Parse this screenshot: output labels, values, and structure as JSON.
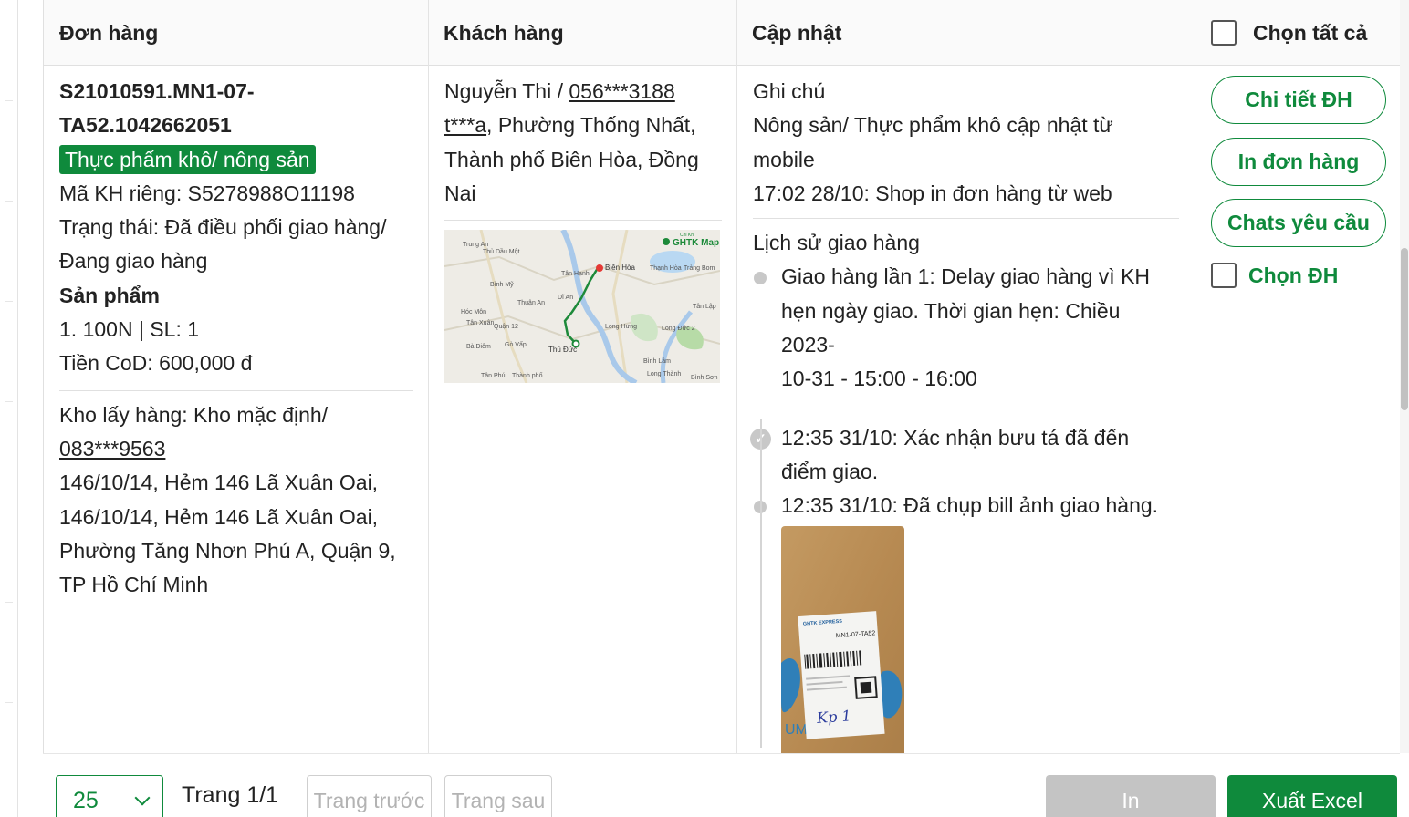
{
  "header": {
    "col_order": "Đơn hàng",
    "col_customer": "Khách hàng",
    "col_update": "Cập nhật",
    "select_all": "Chọn tất cả"
  },
  "order": {
    "code_line1": "S21010591.MN1-07-",
    "code_line2": "TA52.1042662051",
    "tag": "Thực phẩm khô/ nông sản",
    "customer_code": "Mã KH riêng: S5278988O11198",
    "status_line1": "Trạng thái: Đã điều phối giao hàng/",
    "status_line2": "Đang giao hàng",
    "products_heading": "Sản phẩm",
    "product_item": "1. 100N | SL: 1",
    "cod": "Tiền CoD: 600,000 đ",
    "pickup_prefix": "Kho lấy hàng: Kho mặc định/",
    "pickup_phone": "083***9563",
    "pickup_addr_line1": "146/10/14, Hẻm 146 Lã Xuân Oai,",
    "pickup_addr_line2": "146/10/14, Hẻm 146 Lã Xuân Oai,",
    "pickup_addr_line3": "Phường Tăng Nhơn Phú A, Quận 9,",
    "pickup_addr_line4": "TP Hồ Chí Minh"
  },
  "customer": {
    "name_prefix": "Nguyễn Thi / ",
    "phone": "056***3188",
    "addr_masked": "t***a",
    "addr_rest_line1": ", Phường Thống Nhất,",
    "addr_line2": "Thành phố Biên Hòa, Đồng",
    "addr_line3": "Nai",
    "map": {
      "brand": "GHTK Map",
      "brand_sup": "Chi Khi",
      "labels": [
        "Trung An",
        "Thủ Dầu Một",
        "Biên Hòa",
        "Tân Hạnh",
        "Thạnh Hòa",
        "Trảng Bom",
        "Bình Mỹ",
        "Dĩ An",
        "Thuận An",
        "Hóc Môn",
        "Tân Xuân",
        "Quận 12",
        "Tân Lập",
        "Long Hưng",
        "Long Đức 2",
        "Gò Vấp",
        "Bà Điểm",
        "Thủ Đức",
        "Bình Lâm",
        "Tân Phú",
        "Thành phố",
        "Long Thành",
        "Bình Sơn"
      ]
    }
  },
  "update": {
    "note_title": "Ghi chú",
    "note_line1": "Nông sản/ Thực phẩm khô cập nhật từ",
    "note_line2": "mobile",
    "note_line3": "17:02 28/10: Shop in đơn hàng từ web",
    "history_title": "Lịch sử giao hàng",
    "history_line1": "Giao hàng lần 1: Delay giao hàng vì KH",
    "history_line2": "hẹn ngày giao. Thời gian hẹn: Chiều 2023-",
    "history_line3": "10-31 - 15:00 - 16:00",
    "event1_line1": "12:35 31/10: Xác nhận bưu tá đã đến",
    "event1_line2": "điểm giao.",
    "event2": "12:35 31/10: Đã chụp bill ảnh giao hàng.",
    "photo": {
      "label_brand": "GHTK EXPRESS",
      "label_code": "MN1-07-TA52",
      "handwriting": "Kp 1",
      "box_print": "UM"
    }
  },
  "actions": {
    "detail": "Chi tiết ĐH",
    "print_order": "In đơn hàng",
    "chats": "Chats yêu cầu",
    "select": "Chọn ĐH"
  },
  "footer": {
    "page_size": "25",
    "page_label": "Trang 1/1",
    "prev": "Trang trước",
    "next": "Trang sau",
    "print": "In",
    "export": "Xuất Excel"
  },
  "colors": {
    "brand_green": "#0f8a3c",
    "disabled_gray": "#c4c4c4"
  }
}
